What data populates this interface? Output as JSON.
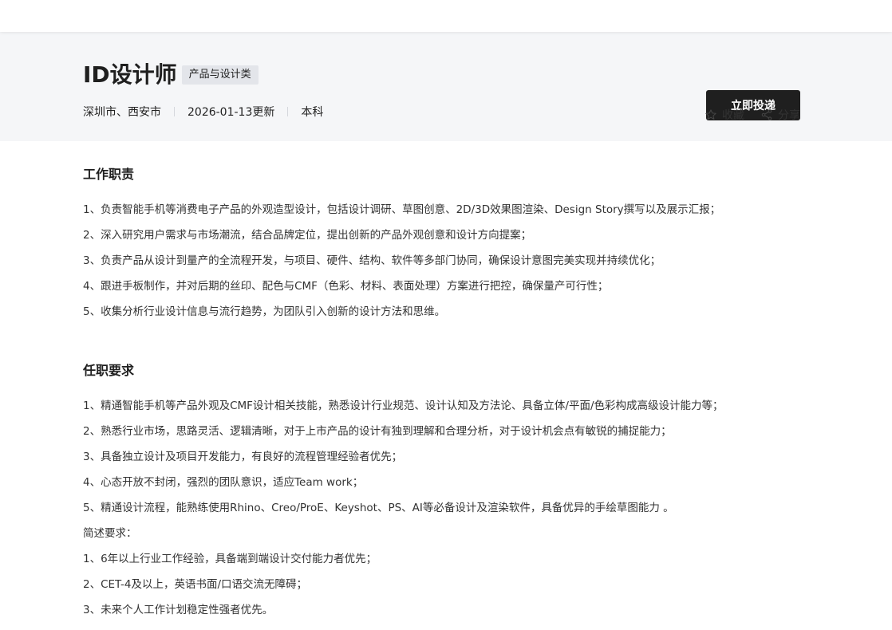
{
  "job": {
    "title": "ID设计师",
    "tag": "产品与设计类",
    "location": "深圳市、西安市",
    "updated": "2026-01-13更新",
    "education": "本科"
  },
  "actions": {
    "apply_label": "立即投递",
    "favorite_label": "收藏",
    "share_label": "分享"
  },
  "sections": [
    {
      "title": "工作职责",
      "items": [
        "1、负责智能手机等消费电子产品的外观造型设计，包括设计调研、草图创意、2D/3D效果图渲染、Design Story撰写以及展示汇报；",
        "2、深入研究用户需求与市场潮流，结合品牌定位，提出创新的产品外观创意和设计方向提案；",
        "3、负责产品从设计到量产的全流程开发，与项目、硬件、结构、软件等多部门协同，确保设计意图完美实现并持续优化；",
        "4、跟进手板制作，并对后期的丝印、配色与CMF（色彩、材料、表面处理）方案进行把控，确保量产可行性；",
        "5、收集分析行业设计信息与流行趋势，为团队引入创新的设计方法和思维。"
      ]
    },
    {
      "title": "任职要求",
      "items": [
        "1、精通智能手机等产品外观及CMF设计相关技能，熟悉设计行业规范、设计认知及方法论、具备立体/平面/色彩构成高级设计能力等；",
        "2、熟悉行业市场，思路灵活、逻辑清晰，对于上市产品的设计有独到理解和合理分析，对于设计机会点有敏锐的捕捉能力；",
        "3、具备独立设计及项目开发能力，有良好的流程管理经验者优先；",
        "4、心态开放不封闭，强烈的团队意识，适应Team work；",
        "5、精通设计流程，能熟练使用Rhino、Creo/ProE、Keyshot、PS、AI等必备设计及渲染软件，具备优异的手绘草图能力 。",
        "简述要求：",
        "1、6年以上行业工作经验，具备端到端设计交付能力者优先；",
        "2、CET-4及以上，英语书面/口语交流无障碍；",
        "3、未来个人工作计划稳定性强者优先。"
      ]
    }
  ],
  "icons": {
    "favorite": "star-outline-icon",
    "share": "share-nodes-icon"
  }
}
